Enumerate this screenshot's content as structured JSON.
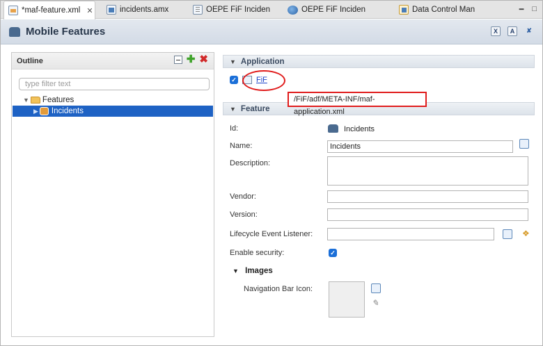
{
  "tabs": [
    {
      "label": "*maf-feature.xml",
      "icon": "xml-file-icon",
      "active": true,
      "close": "✕"
    },
    {
      "label": "incidents.amx",
      "icon": "amx-file-icon",
      "active": false
    },
    {
      "label": "OEPE FiF Inciden",
      "icon": "document-icon",
      "active": false
    },
    {
      "label": "OEPE FiF Inciden",
      "icon": "globe-icon",
      "active": false
    },
    {
      "label": "Data Control Man",
      "icon": "data-control-icon",
      "active": false
    }
  ],
  "header": {
    "title": "Mobile Features"
  },
  "outline": {
    "title": "Outline",
    "filter_placeholder": "type filter text",
    "tree": [
      {
        "label": "Features",
        "expanded": true
      },
      {
        "label": "Incidents",
        "selected": true
      }
    ]
  },
  "application": {
    "section_title": "Application",
    "checked": true,
    "link_label": "FiF",
    "tooltip": "/FiF/adf/META-INF/maf-application.xml"
  },
  "feature": {
    "section_title": "Feature",
    "id_label": "Id:",
    "id_value": "Incidents",
    "name_label": "Name:",
    "name_value": "Incidents",
    "description_label": "Description:",
    "description_value": "",
    "vendor_label": "Vendor:",
    "vendor_value": "",
    "version_label": "Version:",
    "version_value": "",
    "lifecycle_label": "Lifecycle Event Listener:",
    "lifecycle_value": "",
    "security_label": "Enable security:",
    "security_enabled": true
  },
  "images": {
    "section_title": "Images",
    "nav_bar_icon_label": "Navigation Bar Icon:"
  },
  "colors": {
    "selection": "#1e62c4",
    "highlight": "#e01b1b",
    "link": "#1942c8"
  }
}
